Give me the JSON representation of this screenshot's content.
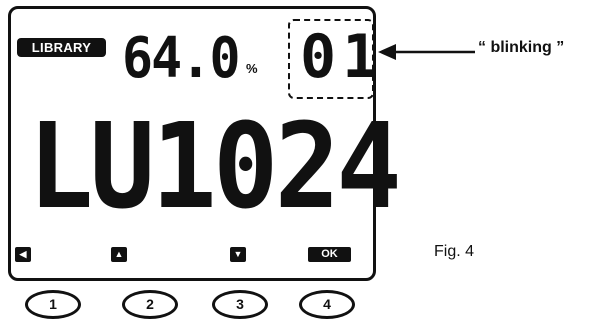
{
  "display": {
    "library_label": "LIBRARY",
    "percent_value": "64.0",
    "percent_unit": "%",
    "track_number": "01",
    "main_readout": "LU1024",
    "key_left_icon": "left-arrow-icon",
    "key_up_icon": "up-arrow-icon",
    "key_down_icon": "down-arrow-icon",
    "key_ok_label": "OK"
  },
  "buttons": [
    {
      "label": "1"
    },
    {
      "label": "2"
    },
    {
      "label": "3"
    },
    {
      "label": "4"
    }
  ],
  "callout": {
    "label": "“ blinking ”"
  },
  "figure": {
    "label": "Fig. 4"
  }
}
